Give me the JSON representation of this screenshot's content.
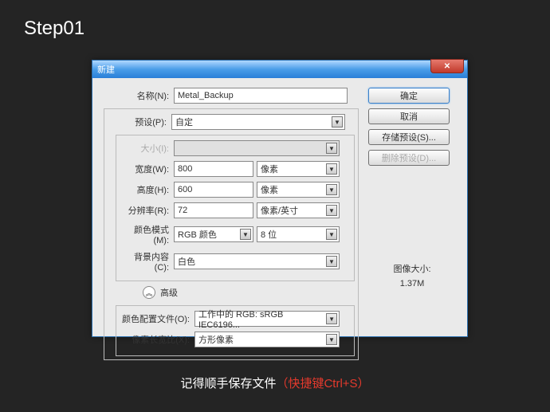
{
  "step": "Step01",
  "dialog": {
    "title": "新建",
    "close": "✕",
    "name_label": "名称(N):",
    "name_value": "Metal_Backup",
    "preset_label": "预设(P):",
    "preset_value": "自定",
    "size_label": "大小(I):",
    "width_label": "宽度(W):",
    "width_value": "800",
    "width_unit": "像素",
    "height_label": "高度(H):",
    "height_value": "600",
    "height_unit": "像素",
    "res_label": "分辨率(R):",
    "res_value": "72",
    "res_unit": "像素/英寸",
    "mode_label": "颜色模式(M):",
    "mode_value": "RGB 颜色",
    "depth_value": "8 位",
    "bg_label": "背景内容(C):",
    "bg_value": "白色",
    "advanced": "高级",
    "profile_label": "颜色配置文件(O):",
    "profile_value": "工作中的 RGB: sRGB IEC6196...",
    "aspect_label": "像素长宽比(X):",
    "aspect_value": "方形像素",
    "ok": "确定",
    "cancel": "取消",
    "save_preset": "存储预设(S)...",
    "delete_preset": "删除预设(D)...",
    "img_size_label": "图像大小:",
    "img_size_value": "1.37M"
  },
  "footer": {
    "text1": "记得顺手保存文件",
    "text2": "（快捷键Ctrl+S）"
  }
}
